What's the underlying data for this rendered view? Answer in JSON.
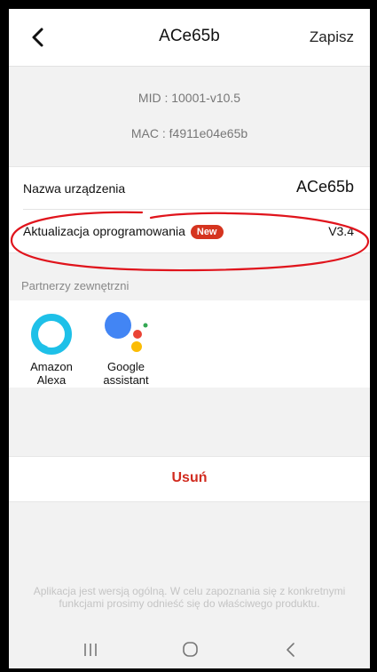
{
  "header": {
    "title": "ACe65b",
    "save_label": "Zapisz"
  },
  "device_info": {
    "mid": "MID : 10001-v10.5",
    "mac": "MAC : f4911e04e65b"
  },
  "settings": {
    "name_label": "Nazwa urządzenia",
    "name_value": "ACe65b",
    "firmware_label": "Aktualizacja oprogramowania",
    "firmware_badge": "New",
    "firmware_version": "V3.4"
  },
  "partners": {
    "title": "Partnerzy zewnętrzni",
    "items": [
      {
        "line1": "Amazon",
        "line2": "Alexa",
        "icon": "alexa-icon"
      },
      {
        "line1": "Google",
        "line2": "assistant",
        "icon": "google-assistant-icon"
      }
    ]
  },
  "delete_label": "Usuń",
  "disclaimer": "Aplikacja jest wersją ogólną. W celu zapoznania się z konkretnymi funkcjami prosimy odnieść się do właściwego produktu.",
  "colors": {
    "accent_red": "#d12b1f",
    "badge_red": "#d5341f",
    "alexa_blue": "#1ec0e8",
    "annotation_red": "#e0141c"
  }
}
